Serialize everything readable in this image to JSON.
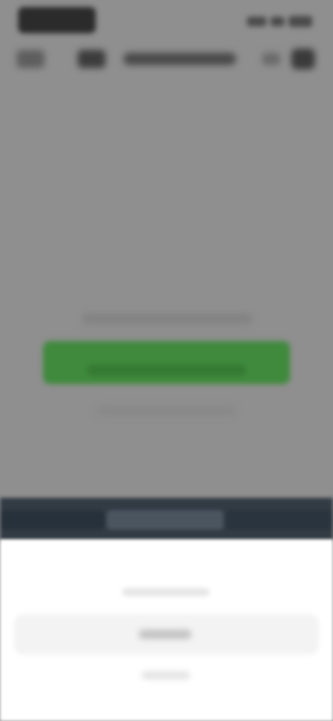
{
  "status_bar": {
    "time": "",
    "icons": [
      "signal-icon",
      "wifi-icon",
      "battery-icon"
    ]
  },
  "app_bar": {
    "title": "",
    "back_icon": "back-icon",
    "app_icon": "app-icon",
    "action_icon": "more-icon"
  },
  "main": {
    "hint_text": "",
    "primary_button_label": "",
    "sub_hint_text": ""
  },
  "tab_strip": {
    "tabs": [
      "",
      "",
      ""
    ]
  },
  "bottom_sheet": {
    "title": "",
    "option_label": "",
    "cancel_label": ""
  },
  "colors": {
    "background": "#8f8f8f",
    "primary_button": "#3f8a3c",
    "tab_strip": "#323b44",
    "sheet": "#ffffff"
  }
}
